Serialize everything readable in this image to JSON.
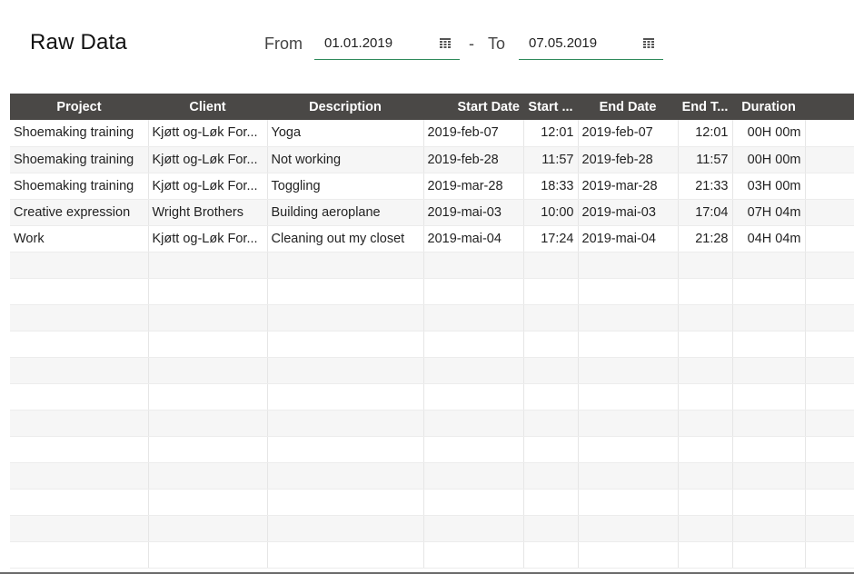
{
  "page": {
    "title": "Raw Data"
  },
  "filter": {
    "from_label": "From",
    "from_value": "01.01.2019",
    "separator": "-",
    "to_label": "To",
    "to_value": "07.05.2019",
    "calendar_icon": "calendar-icon",
    "accent_color": "#2f8a5b"
  },
  "table": {
    "header_color": "#4a4846",
    "columns": [
      "Project",
      "Client",
      "Description",
      "Start Date",
      "Start ...",
      "End Date",
      "End T...",
      "Duration"
    ],
    "rows": [
      [
        "Shoemaking training",
        "Kjøtt og-Løk For...",
        "Yoga",
        "2019-feb-07",
        "12:01",
        "2019-feb-07",
        "12:01",
        "00H 00m"
      ],
      [
        "Shoemaking training",
        "Kjøtt og-Løk For...",
        "Not working",
        "2019-feb-28",
        "11:57",
        "2019-feb-28",
        "11:57",
        "00H 00m"
      ],
      [
        "Shoemaking training",
        "Kjøtt og-Løk For...",
        "Toggling",
        "2019-mar-28",
        "18:33",
        "2019-mar-28",
        "21:33",
        "03H 00m"
      ],
      [
        "Creative expression",
        "Wright Brothers",
        "Building aeroplane",
        "2019-mai-03",
        "10:00",
        "2019-mai-03",
        "17:04",
        "07H 04m"
      ],
      [
        "Work",
        "Kjøtt og-Løk For...",
        "Cleaning out my closet",
        "2019-mai-04",
        "17:24",
        "2019-mai-04",
        "21:28",
        "04H 04m"
      ]
    ]
  }
}
